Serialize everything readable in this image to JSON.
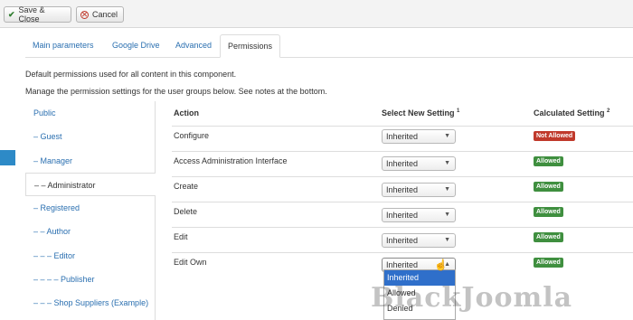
{
  "toolbar": {
    "save_close_label": "Save & Close",
    "cancel_label": "Cancel"
  },
  "tabs": [
    {
      "label": "Main parameters"
    },
    {
      "label": "Google Drive"
    },
    {
      "label": "Advanced"
    },
    {
      "label": "Permissions",
      "active": true
    }
  ],
  "intro": {
    "line1": "Default permissions used for all content in this component.",
    "line2": "Manage the permission settings for the user groups below. See notes at the bottom."
  },
  "groups": [
    {
      "label": "Public"
    },
    {
      "label": "– Guest"
    },
    {
      "label": "– Manager"
    },
    {
      "label": "– – Administrator",
      "active": true
    },
    {
      "label": "– Registered"
    },
    {
      "label": "– – Author"
    },
    {
      "label": "– – – Editor"
    },
    {
      "label": "– – – – Publisher"
    },
    {
      "label": "– – – Shop Suppliers (Example)"
    }
  ],
  "table": {
    "headers": {
      "action": "Action",
      "select": "Select New Setting",
      "select_note": "1",
      "calculated": "Calculated Setting",
      "calculated_note": "2"
    },
    "rows": [
      {
        "action": "Configure",
        "setting": "Inherited",
        "calculated": "Not Allowed"
      },
      {
        "action": "Access Administration Interface",
        "setting": "Inherited",
        "calculated": "Allowed"
      },
      {
        "action": "Create",
        "setting": "Inherited",
        "calculated": "Allowed"
      },
      {
        "action": "Delete",
        "setting": "Inherited",
        "calculated": "Allowed"
      },
      {
        "action": "Edit",
        "setting": "Inherited",
        "calculated": "Allowed"
      },
      {
        "action": "Edit Own",
        "setting": "Inherited",
        "calculated": "Allowed"
      }
    ]
  },
  "dropdown_options": [
    {
      "label": "Inherited",
      "selected": true
    },
    {
      "label": "Allowed"
    },
    {
      "label": "Denied"
    }
  ],
  "watermark": "BlackJoomla",
  "colors": {
    "link": "#2a6fb0",
    "allowed": "#3f8f3f",
    "not_allowed": "#c0392b",
    "accent": "#2d8ac7",
    "selected_option": "#2f6fca"
  },
  "icons": {
    "save": "check-icon",
    "cancel": "cancel-circle-icon",
    "select_caret": "caret-down-icon",
    "cursor": "hand-pointer-icon"
  }
}
